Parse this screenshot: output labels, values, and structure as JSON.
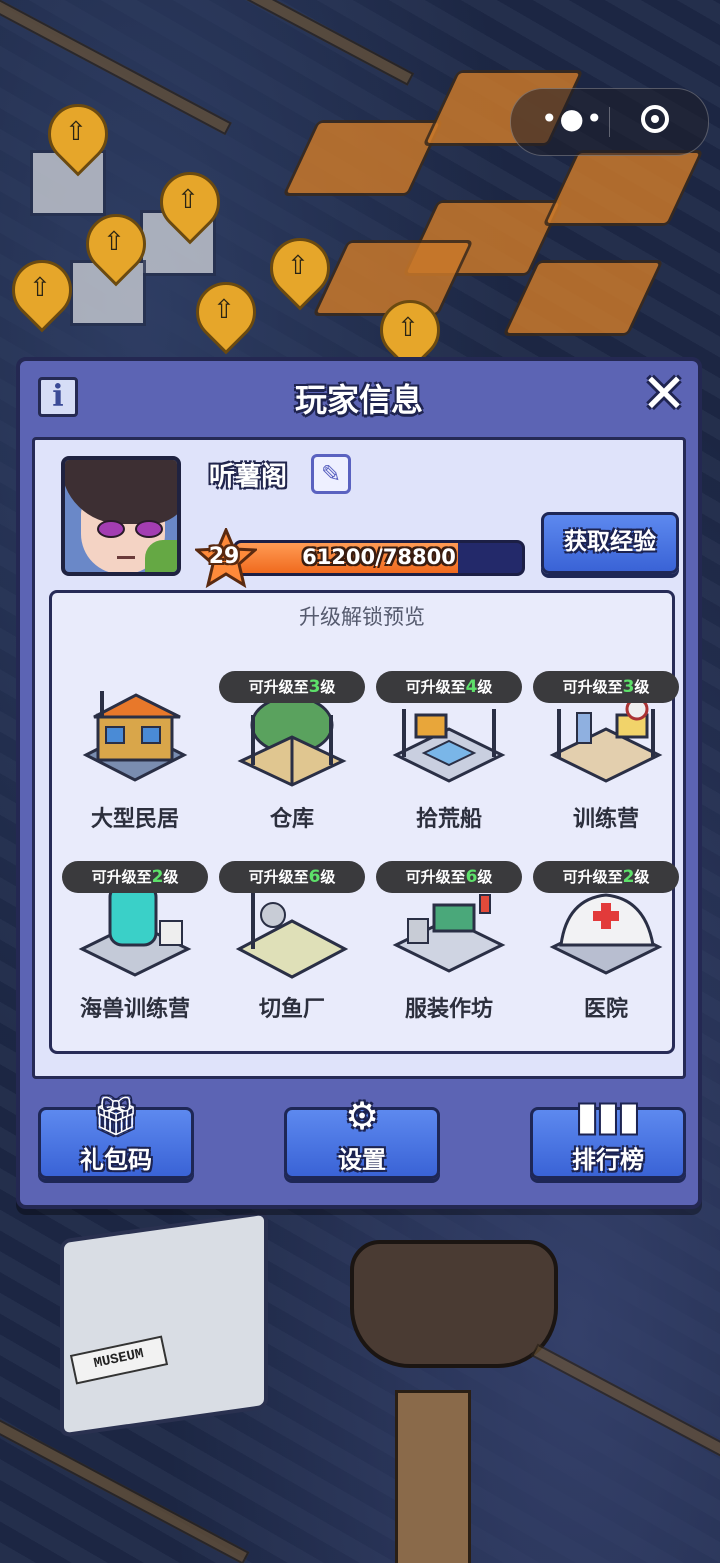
{
  "dialog": {
    "title": "玩家信息",
    "info_icon": "info-icon",
    "close_icon": "close-icon"
  },
  "player": {
    "name": "听薯阁",
    "level": "29",
    "xp_text": "61200/78800",
    "xp_progress": 0.777,
    "get_exp_label": "获取经验"
  },
  "preview": {
    "title": "升级解锁预览",
    "items": [
      {
        "name": "大型民居",
        "badge_prefix": "",
        "badge_level": "",
        "badge_suffix": "",
        "icon": "house-building-icon"
      },
      {
        "name": "仓库",
        "badge_prefix": "可升级至",
        "badge_level": "3",
        "badge_suffix": "级",
        "icon": "warehouse-building-icon"
      },
      {
        "name": "拾荒船",
        "badge_prefix": "可升级至",
        "badge_level": "4",
        "badge_suffix": "级",
        "icon": "scavenger-boat-icon"
      },
      {
        "name": "训练营",
        "badge_prefix": "可升级至",
        "badge_level": "3",
        "badge_suffix": "级",
        "icon": "training-camp-icon"
      },
      {
        "name": "海兽训练营",
        "badge_prefix": "可升级至",
        "badge_level": "2",
        "badge_suffix": "级",
        "icon": "sea-beast-camp-icon"
      },
      {
        "name": "切鱼厂",
        "badge_prefix": "可升级至",
        "badge_level": "6",
        "badge_suffix": "级",
        "icon": "fish-factory-icon"
      },
      {
        "name": "服装作坊",
        "badge_prefix": "可升级至",
        "badge_level": "6",
        "badge_suffix": "级",
        "icon": "clothing-workshop-icon"
      },
      {
        "name": "医院",
        "badge_prefix": "可升级至",
        "badge_level": "2",
        "badge_suffix": "级",
        "icon": "hospital-icon"
      }
    ]
  },
  "buttons": {
    "gift_code": "礼包码",
    "settings": "设置",
    "leaderboard": "排行榜"
  },
  "background_signs": {
    "museum": "MUSEUM"
  },
  "colors": {
    "dialog_bg": "#5c64b4",
    "panel_bg": "#dfe3fa",
    "button_blue": "#3a63d6",
    "xp_orange": "#f06a1e",
    "badge_level_green": "#5de06a"
  }
}
